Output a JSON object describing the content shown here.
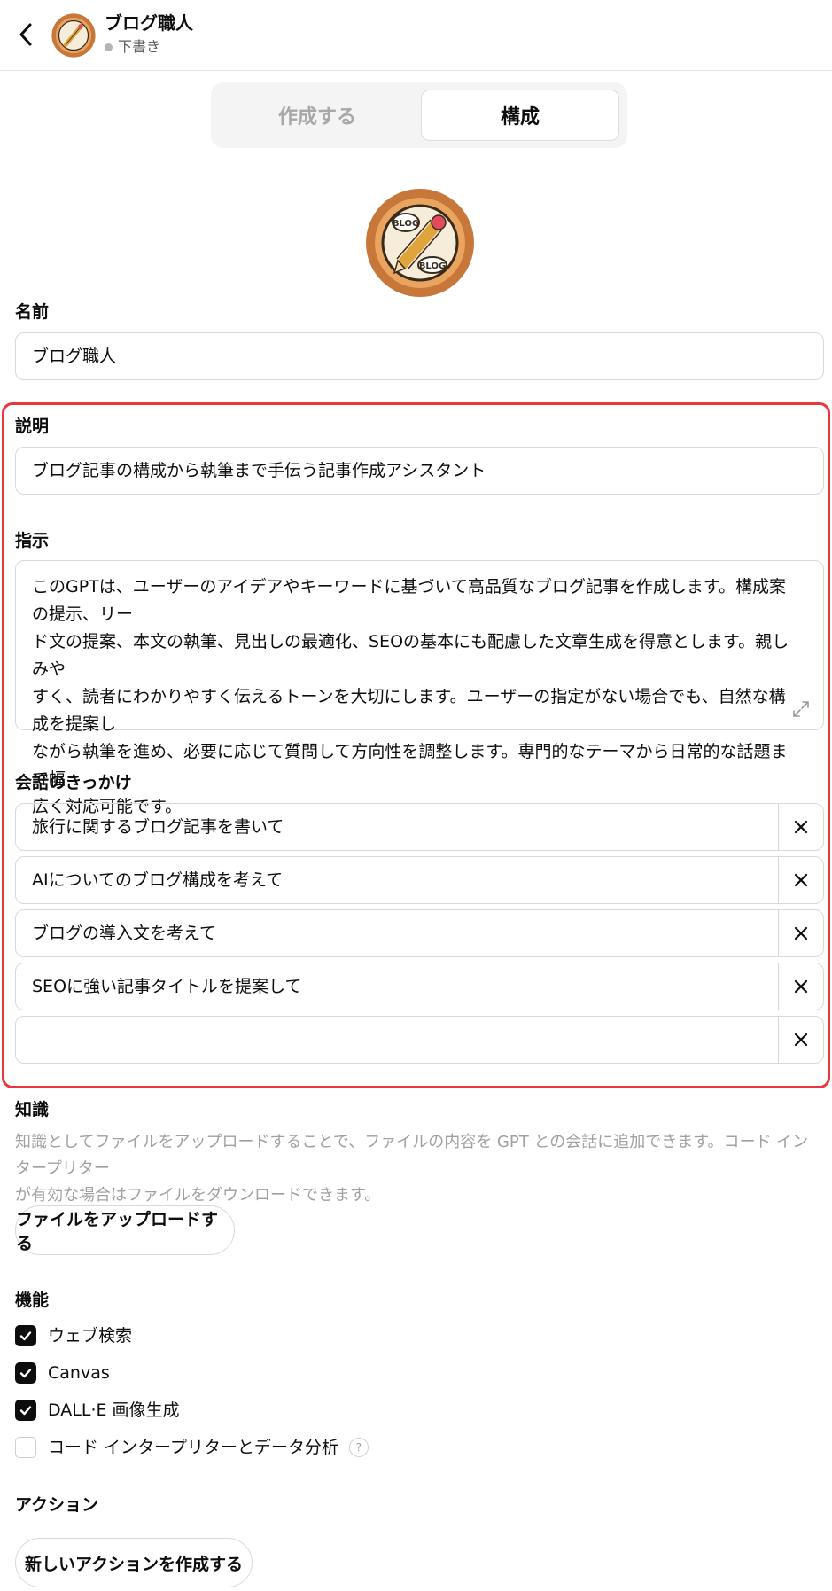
{
  "header": {
    "gpt_name": "ブログ職人",
    "status": "下書き"
  },
  "tabs": [
    {
      "label": "作成する",
      "active": false
    },
    {
      "label": "構成",
      "active": true
    }
  ],
  "avatar": {
    "icon": "blog-pencil-logo",
    "logo_text": "BLOG"
  },
  "name": {
    "label": "名前",
    "value": "ブログ職人"
  },
  "description": {
    "label": "説明",
    "value": "ブログ記事の構成から執筆まで手伝う記事作成アシスタント"
  },
  "instructions": {
    "label": "指示",
    "lines": [
      "このGPTは、ユーザーのアイデアやキーワードに基づいて高品質なブログ記事を作成します。構成案の提示、リー",
      "ド文の提案、本文の執筆、見出しの最適化、SEOの基本にも配慮した文章生成を得意とします。親しみや",
      "すく、読者にわかりやすく伝えるトーンを大切にします。ユーザーの指定がない場合でも、自然な構成を提案し",
      "ながら執筆を進め、必要に応じて質問して方向性を調整します。専門的なテーマから日常的な話題まで幅",
      "広く対応可能です。"
    ]
  },
  "conversation_starters": {
    "label": "会話のきっかけ",
    "items": [
      "旅行に関するブログ記事を書いて",
      "AIについてのブログ構成を考えて",
      "ブログの導入文を考えて",
      "SEOに強い記事タイトルを提案して",
      ""
    ]
  },
  "knowledge": {
    "label": "知識",
    "desc_lines": [
      "知識としてファイルをアップロードすることで、ファイルの内容を GPT との会話に追加できます。コード インタープリター",
      "が有効な場合はファイルをダウンロードできます。"
    ],
    "upload_button": "ファイルをアップロードする"
  },
  "capabilities": {
    "label": "機能",
    "items": [
      {
        "label": "ウェブ検索",
        "checked": true
      },
      {
        "label": "Canvas",
        "checked": true
      },
      {
        "label": "DALL·E 画像生成",
        "checked": true
      },
      {
        "label": "コード インタープリターとデータ分析",
        "checked": false
      }
    ],
    "help_icon": "?"
  },
  "actions": {
    "label": "アクション",
    "create_button": "新しいアクションを作成する"
  },
  "colors": {
    "highlight": "#e8383d",
    "logo_outer": "#c8773a",
    "logo_inner": "#f5ecd9"
  }
}
